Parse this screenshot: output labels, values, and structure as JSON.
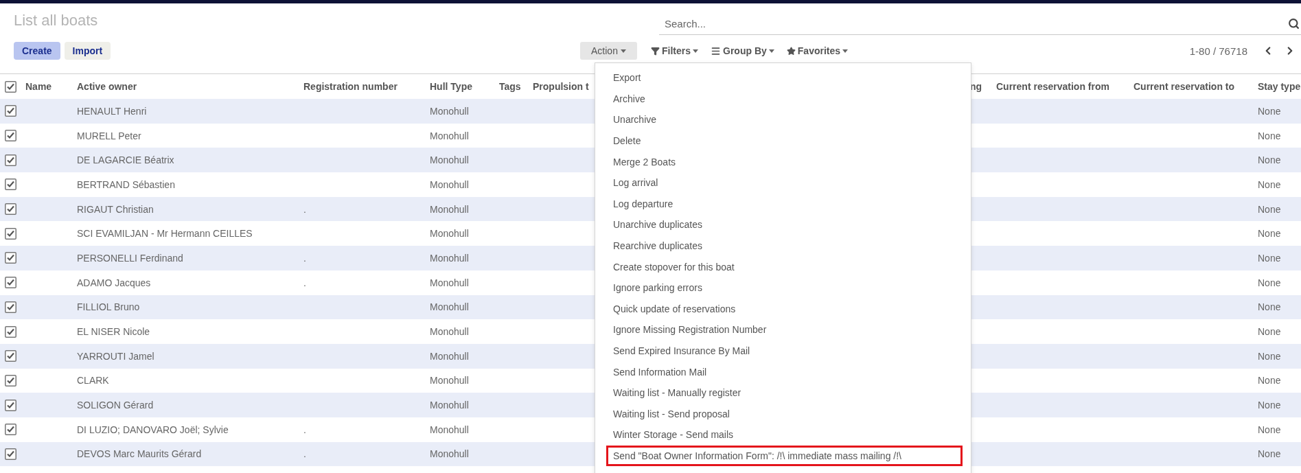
{
  "page": {
    "title": "List all boats"
  },
  "buttons": [
    {
      "label": "Create",
      "kind": "primary"
    },
    {
      "label": "Import",
      "kind": "secondary"
    }
  ],
  "search": {
    "placeholder": "Search..."
  },
  "action_button": {
    "label": "Action",
    "expanded": true
  },
  "filters": [
    {
      "label": "Filters",
      "kind": "filter"
    },
    {
      "label": "Group By",
      "kind": "group"
    },
    {
      "label": "Favorites",
      "kind": "star"
    }
  ],
  "pager": {
    "range": "1-80 / 76718"
  },
  "table": {
    "select_all": {
      "checked": true
    },
    "columns": [
      "Name",
      "Active owner",
      "Registration number",
      "Hull Type",
      "Tags",
      "Propulsion t",
      "ng",
      "Current reservation from",
      "Current reservation to",
      "Stay type"
    ],
    "rows": [
      {
        "selected": true,
        "owner": "HENAULT Henri",
        "hull": "Monohull",
        "stay": "None"
      },
      {
        "selected": true,
        "owner": "MURELL Peter",
        "hull": "Monohull",
        "stay": "None"
      },
      {
        "selected": true,
        "owner": "DE LAGARCIE Béatrix",
        "hull": "Monohull",
        "stay": "None"
      },
      {
        "selected": true,
        "owner": "BERTRAND Sébastien",
        "hull": "Monohull",
        "stay": "None"
      },
      {
        "selected": true,
        "owner": "RIGAUT Christian",
        "registration": ".",
        "hull": "Monohull",
        "stay": "None"
      },
      {
        "selected": true,
        "owner": "SCI EVAMILJAN - Mr Hermann CEILLES",
        "hull": "Monohull",
        "stay": "None"
      },
      {
        "selected": true,
        "owner": "PERSONELLI Ferdinand",
        "registration": ".",
        "hull": "Monohull",
        "stay": "None"
      },
      {
        "selected": true,
        "owner": "ADAMO Jacques",
        "registration": ".",
        "hull": "Monohull",
        "stay": "None"
      },
      {
        "selected": true,
        "owner": "FILLIOL Bruno",
        "hull": "Monohull",
        "stay": "None"
      },
      {
        "selected": true,
        "owner": "EL NISER Nicole",
        "hull": "Monohull",
        "stay": "None"
      },
      {
        "selected": true,
        "owner": "YARROUTI Jamel",
        "hull": "Monohull",
        "stay": "None"
      },
      {
        "selected": true,
        "owner": "CLARK",
        "hull": "Monohull",
        "stay": "None"
      },
      {
        "selected": true,
        "owner": "SOLIGON Gérard",
        "hull": "Monohull",
        "stay": "None"
      },
      {
        "selected": true,
        "owner": "DI LUZIO; DANOVARO Joël; Sylvie",
        "registration": ".",
        "hull": "Monohull",
        "stay": "None"
      },
      {
        "selected": true,
        "owner": "DEVOS Marc Maurits Gérard",
        "registration": ".",
        "hull": "Monohull",
        "stay": "None"
      }
    ]
  },
  "action_menu": {
    "items": [
      {
        "label": "Export",
        "highlighted": false
      },
      {
        "label": "Archive",
        "highlighted": false
      },
      {
        "label": "Unarchive",
        "highlighted": false
      },
      {
        "label": "Delete",
        "highlighted": false
      },
      {
        "label": "Merge 2 Boats",
        "highlighted": false
      },
      {
        "label": "Log arrival",
        "highlighted": false
      },
      {
        "label": "Log departure",
        "highlighted": false
      },
      {
        "label": "Unarchive duplicates",
        "highlighted": false
      },
      {
        "label": "Rearchive duplicates",
        "highlighted": false
      },
      {
        "label": "Create stopover for this boat",
        "highlighted": false
      },
      {
        "label": "Ignore parking errors",
        "highlighted": false
      },
      {
        "label": "Quick update of reservations",
        "highlighted": false
      },
      {
        "label": "Ignore Missing Registration Number",
        "highlighted": false
      },
      {
        "label": "Send Expired Insurance By Mail",
        "highlighted": false
      },
      {
        "label": "Send Information Mail",
        "highlighted": false
      },
      {
        "label": "Waiting list - Manually register",
        "highlighted": false
      },
      {
        "label": "Waiting list - Send proposal",
        "highlighted": false
      },
      {
        "label": "Winter Storage - Send mails",
        "highlighted": false
      },
      {
        "label": "Send \"Boat Owner Information Form\": /!\\ immediate mass mailing /!\\",
        "highlighted": true
      }
    ]
  }
}
